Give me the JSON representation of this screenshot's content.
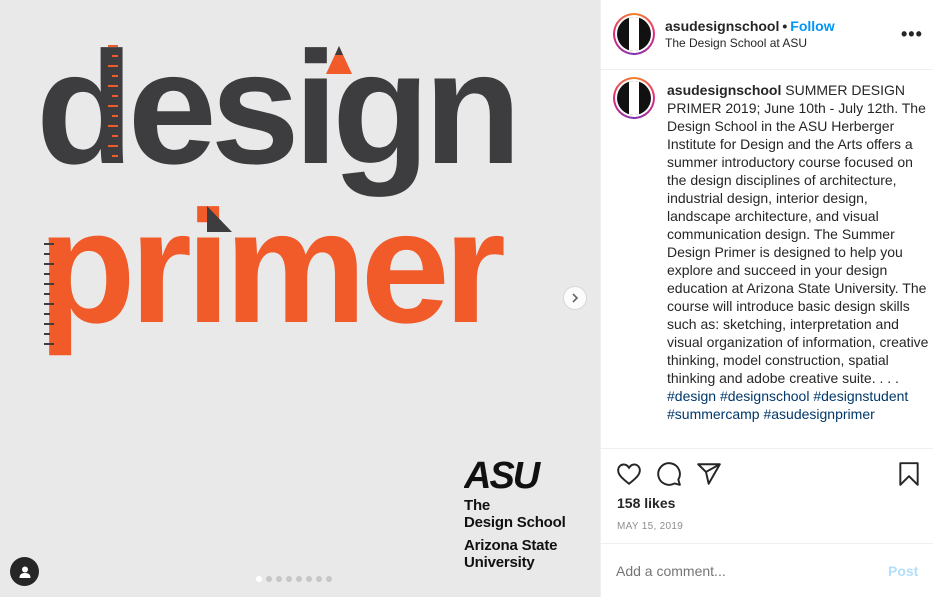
{
  "post_image": {
    "line1": "design",
    "line2": "primer",
    "logo_text": "ASU",
    "school_lines": [
      "The",
      "Design School"
    ],
    "univ_lines": [
      "Arizona State",
      "University"
    ],
    "carousel_count": 8,
    "carousel_active": 1,
    "colors": {
      "dark": "#3d3d3f",
      "orange": "#f15a29",
      "bg": "#e9e9ea"
    }
  },
  "header": {
    "username": "asudesignschool",
    "separator": "•",
    "follow_label": "Follow",
    "subtitle": "The Design School at ASU",
    "more_label": "•••"
  },
  "caption": {
    "username": "asudesignschool",
    "text": "SUMMER DESIGN PRIMER 2019; June 10th - July 12th. The Design School in the ASU Herberger Institute for Design and the Arts offers a summer introductory course focused on the design disciplines of architecture, industrial design, interior design, landscape architecture, and visual communication design. The Summer Design Primer is designed to help you explore and succeed in your design education at Arizona State University. The course will introduce basic design skills such as: sketching, interpretation and visual organization of information, creative thinking, model construction, spatial thinking and adobe creative suite. . . .",
    "hashtags": [
      "#design",
      "#designschool",
      "#designstudent",
      "#summercamp",
      "#asudesignprimer"
    ]
  },
  "actions": {
    "icons": [
      "heart-icon",
      "comment-icon",
      "share-icon",
      "bookmark-icon"
    ],
    "likes": "158 likes",
    "date": "MAY 15, 2019"
  },
  "comment": {
    "placeholder": "Add a comment...",
    "post_label": "Post"
  }
}
